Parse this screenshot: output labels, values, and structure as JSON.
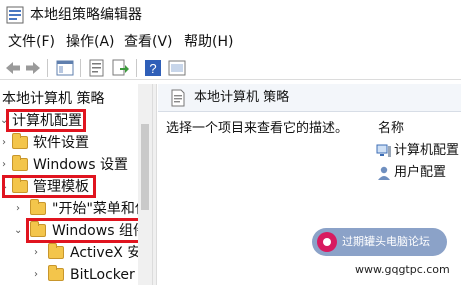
{
  "window": {
    "title": "本地组策略编辑器"
  },
  "menubar": {
    "items": [
      {
        "label": "文件(F)"
      },
      {
        "label": "操作(A)"
      },
      {
        "label": "查看(V)"
      },
      {
        "label": "帮助(H)"
      }
    ]
  },
  "toolbar": {
    "buttons": [
      "back-arrow-icon",
      "forward-arrow-icon",
      "show-hide-tree-icon",
      "properties-icon",
      "export-list-icon",
      "help-icon",
      "filter-view-icon"
    ]
  },
  "tree": {
    "root": "本地计算机 策略",
    "computer_config": "计算机配置",
    "software_settings": "软件设置",
    "windows_settings": "Windows 设置",
    "admin_templates": "管理模板",
    "start_menu": "\"开始\"菜单和任",
    "windows_components": "Windows 组件",
    "activex": "ActiveX 安",
    "bitlocker": "BitLocker 驱"
  },
  "right_pane": {
    "header_title": "本地计算机 策略",
    "description": "选择一个项目来查看它的描述。",
    "column_name": "名称",
    "rows": [
      {
        "label": "计算机配置",
        "icon": "computer-config-icon"
      },
      {
        "label": "用户配置",
        "icon": "user-config-icon"
      }
    ]
  },
  "watermark": {
    "text": "过期罐头电脑论坛",
    "url": "www.gqgtpc.com"
  },
  "colors": {
    "highlight": "#e0141f",
    "folder": "#f3c54b",
    "header_bg": "#f3f6fa"
  }
}
